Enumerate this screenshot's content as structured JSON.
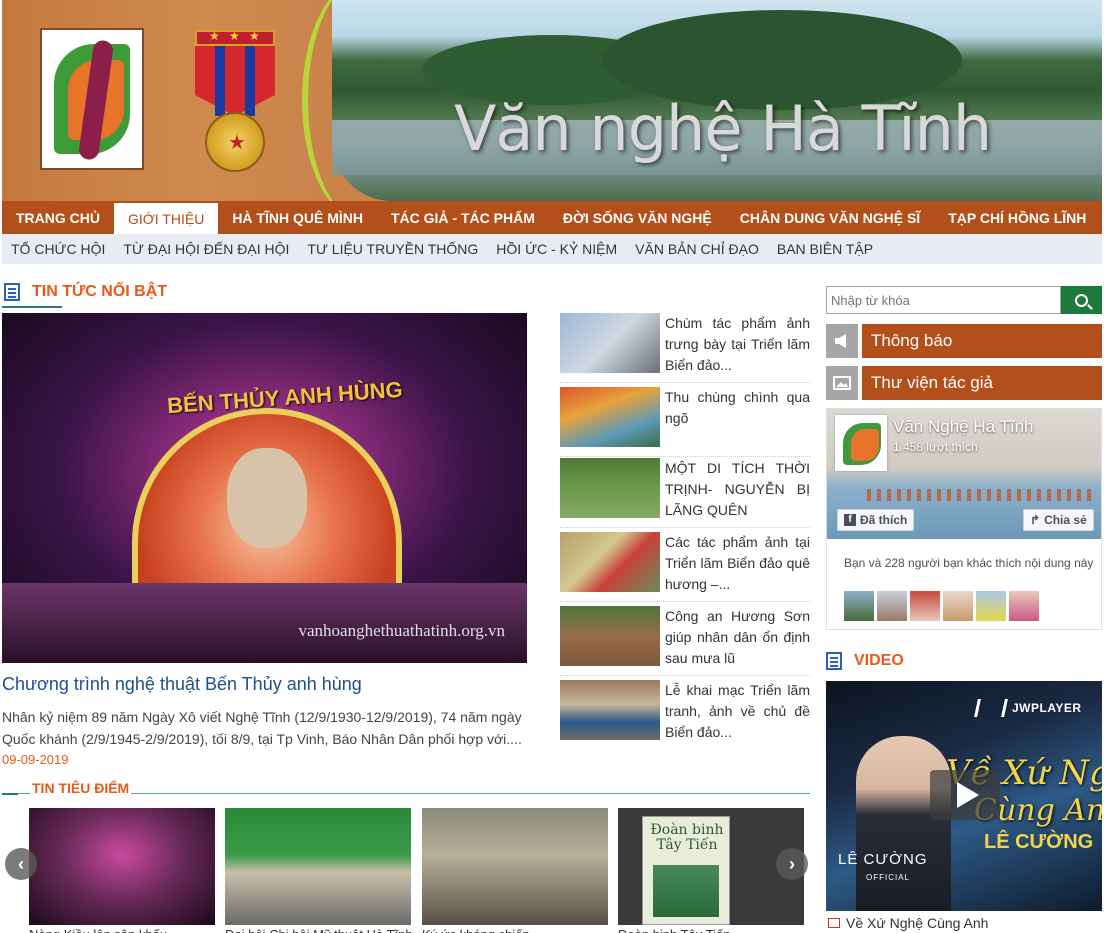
{
  "header": {
    "site_title": "Văn nghệ Hà Tĩnh",
    "colors": {
      "brand": "#b34f1a",
      "accent": "#e8591a",
      "subnav_bg": "#e7ecf2"
    }
  },
  "main_nav": [
    {
      "label": "TRANG CHỦ",
      "active": false
    },
    {
      "label": "GIỚI THIỆU",
      "active": true
    },
    {
      "label": "HÀ TĨNH QUÊ MÌNH",
      "active": false
    },
    {
      "label": "TÁC GIẢ - TÁC PHẨM",
      "active": false
    },
    {
      "label": "ĐỜI SỐNG VĂN NGHỆ",
      "active": false
    },
    {
      "label": "CHÂN DUNG VĂN NGHỆ SĨ",
      "active": false
    },
    {
      "label": "TẠP CHÍ HỒNG LĨNH",
      "active": false
    }
  ],
  "sub_nav": [
    "TỔ CHỨC HỘI",
    "TỪ ĐẠI HỘI ĐẾN ĐẠI HỘI",
    "TƯ LIỆU TRUYỀN THỐNG",
    "HỒI ỨC - KỶ NIỆM",
    "VĂN BẢN CHỈ ĐẠO",
    "BAN BIÊN TẬP"
  ],
  "featured_section": {
    "heading": "TIN TỨC NỔI BẬT",
    "image_sign": "BẾN THỦY ANH HÙNG",
    "image_watermark": "vanhoanghethuathatinh.org.vn",
    "title": "Chương trình nghệ thuật Bến Thủy anh hùng",
    "summary": "Nhân kỷ niệm 89 năm Ngày Xô viết Nghệ Tĩnh (12/9/1930-12/9/2019), 74 năm ngày Quốc khánh (2/9/1945-2/9/2019), tối 8/9, tại Tp Vinh, Báo Nhân Dân phối hợp với....",
    "date": "09-09-2019"
  },
  "side_news": [
    {
      "title": "Chùm tác phẩm ảnh trưng bày tại Triển lãm Biển đảo..."
    },
    {
      "title": "Thu chùng chình qua ngõ"
    },
    {
      "title": "MỘT DI TÍCH THỜI TRỊNH- NGUYỄN BỊ LÃNG QUÊN"
    },
    {
      "title": "Các tác phẩm ảnh tại Triển lãm Biển đảo quê hương –..."
    },
    {
      "title": "Công an Hương Sơn giúp nhân dân ổn định sau mưa lũ"
    },
    {
      "title": "Lễ khai mạc Triển lãm tranh, ảnh về chủ đề Biển đảo..."
    }
  ],
  "tieu_diem": {
    "heading": "TIN TIÊU ĐIỂM",
    "prev_label": "‹",
    "next_label": "›",
    "items": [
      {
        "caption": "Nàng Kiều lên sân khấu"
      },
      {
        "caption": "Đại hội Chi hội Mỹ thuật Hà Tĩnh"
      },
      {
        "caption": "Ký ức kháng chiến"
      },
      {
        "caption": "Đoàn binh Tây Tiến"
      }
    ],
    "book_title": "Đoàn binh Tây Tiến"
  },
  "sidebar": {
    "search_placeholder": "Nhập từ khóa",
    "boxes": [
      {
        "label": "Thông báo",
        "icon": "megaphone-icon"
      },
      {
        "label": "Thư viện tác giả",
        "icon": "image-icon"
      }
    ],
    "facebook": {
      "page_name": "Văn Nghệ Hà Tĩnh",
      "likes": "1.458 lượt thích",
      "liked_label": "Đã thích",
      "share_label": "Chia sẻ",
      "friends_text": "Bạn và 228 người bạn khác thích nội dung này"
    },
    "video": {
      "heading": "VIDEO",
      "player_brand": "JWPLAYER",
      "overlay_line1": "Về Xứ Nghệ",
      "overlay_line2": "Cùng Anh",
      "overlay_line3": "LÊ CƯỜNG",
      "artist": "LÊ CƯỜNG",
      "official": "OFFICIAL",
      "caption": "Về Xứ Nghệ Cùng Anh"
    }
  }
}
